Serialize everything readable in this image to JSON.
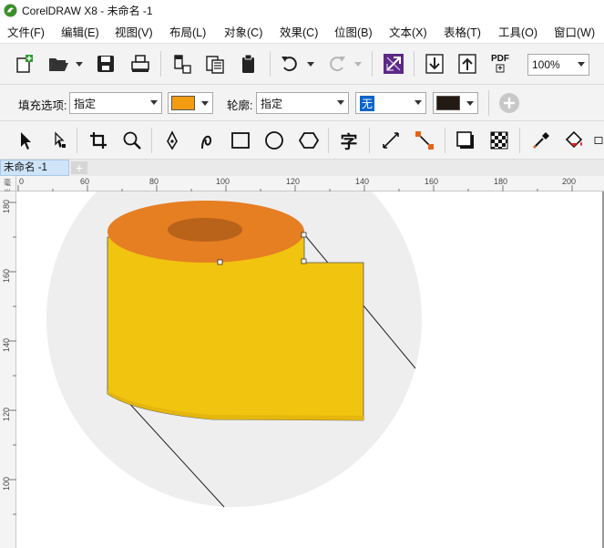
{
  "window": {
    "title": "CorelDRAW X8 - 未命名 -1"
  },
  "menu": [
    {
      "label": "文件(F)"
    },
    {
      "label": "编辑(E)"
    },
    {
      "label": "视图(V)"
    },
    {
      "label": "布局(L)"
    },
    {
      "label": "对象(C)"
    },
    {
      "label": "效果(C)"
    },
    {
      "label": "位图(B)"
    },
    {
      "label": "文本(X)"
    },
    {
      "label": "表格(T)"
    },
    {
      "label": "工具(O)"
    },
    {
      "label": "窗口(W)"
    }
  ],
  "standard_toolbar": {
    "zoom_value": "100%",
    "pdf_label": "PDF"
  },
  "property_bar": {
    "fill_label": "填充选项:",
    "fill_value": "指定",
    "fill_color": "#f39c12",
    "outline_label": "轮廓:",
    "outline_value": "指定",
    "outline_width": "无",
    "outline_color": "#231a13"
  },
  "toolbox": {
    "text_tool_glyph": "字"
  },
  "document_tabs": [
    {
      "label": "未命名 -1",
      "active": true
    }
  ],
  "ruler": {
    "unit_label": "毫米",
    "horizontal_ticks": [
      "0",
      "60",
      "80",
      "100",
      "120",
      "140",
      "160",
      "180",
      "200"
    ],
    "vertical_ticks": [
      "180",
      "160",
      "140",
      "120",
      "100"
    ]
  },
  "artwork": {
    "background_circle_color": "#eeeeee",
    "tape_top_color": "#e67e22",
    "tape_hole_color": "#b8621a",
    "tape_side_color": "#f1c40f",
    "tape_shadow_color": "#e5b60e"
  }
}
